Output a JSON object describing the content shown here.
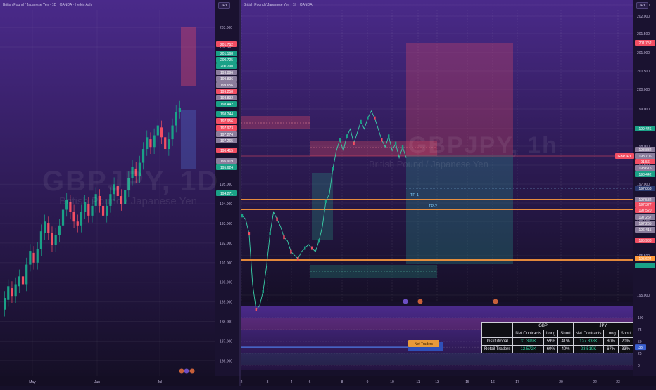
{
  "left_pane": {
    "title": "British Pound / Japanese Yen · 1D · OANDA · Heikin Ashi",
    "currency": "JPY",
    "watermark_symbol": "GBPJPY, 1D",
    "watermark_name": "British Pound / Japanese Yen"
  },
  "right_pane": {
    "title": "British Pound / Japanese Yen · 1h · OANDA",
    "currency": "JPY",
    "watermark_symbol": "GBPJPY, 1h",
    "watermark_name": "British Pound / Japanese Yen"
  },
  "colors": {
    "bull": "#1aa187",
    "bear": "#f24e63",
    "level_line": "#ff9a3c",
    "background_top": "#4a2a8a",
    "background_bottom": "#150f26"
  },
  "chart_data": [
    {
      "type": "candlestick",
      "name": "daily",
      "x_ticks": [
        "May",
        "Jun",
        "Jul"
      ],
      "y_ticks": [
        "203.000",
        "202.000",
        "195.000",
        "194.000",
        "193.000",
        "192.000",
        "191.000",
        "190.000",
        "189.000",
        "188.000",
        "187.000",
        "186.000"
      ],
      "ylim": [
        185.4,
        203.9
      ],
      "candles": [
        {
          "o": 188.6,
          "c": 189.2
        },
        {
          "o": 189.1,
          "c": 189.8
        },
        {
          "o": 189.7,
          "c": 189.3
        },
        {
          "o": 189.3,
          "c": 189.9
        },
        {
          "o": 189.8,
          "c": 190.3
        },
        {
          "o": 190.3,
          "c": 189.9
        },
        {
          "o": 189.9,
          "c": 190.9
        },
        {
          "o": 190.9,
          "c": 191.6
        },
        {
          "o": 191.5,
          "c": 191.0
        },
        {
          "o": 191.0,
          "c": 191.7
        },
        {
          "o": 191.7,
          "c": 192.6
        },
        {
          "o": 192.5,
          "c": 193.1
        },
        {
          "o": 193.0,
          "c": 192.5
        },
        {
          "o": 192.5,
          "c": 191.9
        },
        {
          "o": 191.9,
          "c": 192.4
        },
        {
          "o": 192.4,
          "c": 192.9
        },
        {
          "o": 192.9,
          "c": 193.7
        },
        {
          "o": 193.7,
          "c": 194.2
        },
        {
          "o": 194.1,
          "c": 193.6
        },
        {
          "o": 193.6,
          "c": 193.1
        },
        {
          "o": 193.1,
          "c": 192.9
        },
        {
          "o": 192.9,
          "c": 193.6
        },
        {
          "o": 193.6,
          "c": 194.1
        },
        {
          "o": 194.0,
          "c": 193.4
        },
        {
          "o": 193.4,
          "c": 193.9
        },
        {
          "o": 193.9,
          "c": 194.5
        },
        {
          "o": 194.4,
          "c": 193.9
        },
        {
          "o": 193.9,
          "c": 193.4
        },
        {
          "o": 193.4,
          "c": 193.9
        },
        {
          "o": 193.9,
          "c": 194.5
        },
        {
          "o": 194.5,
          "c": 195.0
        },
        {
          "o": 194.9,
          "c": 194.4
        },
        {
          "o": 194.4,
          "c": 194.0
        },
        {
          "o": 194.0,
          "c": 194.7
        },
        {
          "o": 194.7,
          "c": 195.3
        },
        {
          "o": 195.3,
          "c": 195.9
        },
        {
          "o": 195.8,
          "c": 195.4
        },
        {
          "o": 195.4,
          "c": 196.1
        },
        {
          "o": 196.1,
          "c": 196.8
        },
        {
          "o": 196.8,
          "c": 197.4
        },
        {
          "o": 197.3,
          "c": 196.9
        },
        {
          "o": 196.9,
          "c": 197.5
        },
        {
          "o": 197.5,
          "c": 198.0
        },
        {
          "o": 197.9,
          "c": 197.4
        },
        {
          "o": 197.4,
          "c": 196.8
        },
        {
          "o": 196.8,
          "c": 197.3
        },
        {
          "o": 197.3,
          "c": 198.0
        },
        {
          "o": 198.0,
          "c": 198.7
        },
        {
          "o": 198.7,
          "c": 198.9
        }
      ]
    },
    {
      "type": "line",
      "name": "hourly",
      "x_ticks": [
        "2",
        "3",
        "4",
        "6",
        "8",
        "9",
        "10",
        "11",
        "13",
        "15",
        "16",
        "17",
        "20",
        "22",
        "23"
      ],
      "y_ticks": [
        "202.500",
        "202.000",
        "201.500",
        "201.000",
        "200.500",
        "200.000",
        "199.000",
        "198.500",
        "198.000",
        "197.500",
        "197.000",
        "196.500",
        "196.000",
        "195.500",
        "195.000"
      ],
      "ylim": [
        194.7,
        202.7
      ],
      "series": [
        {
          "values": [
            197.0,
            196.9,
            196.5,
            195.1,
            194.4,
            194.5,
            194.9,
            195.6,
            196.5,
            197.1,
            196.9,
            196.7,
            196.4,
            196.3,
            196.0,
            195.9,
            195.8,
            196.0,
            196.1,
            196.2,
            196.1,
            196.0,
            196.3,
            196.7,
            197.4,
            197.6,
            198.3,
            198.8,
            199.1,
            198.8,
            199.2,
            199.4,
            199.0,
            199.3,
            199.6,
            199.4,
            199.7,
            199.9,
            199.7,
            199.4,
            199.1,
            198.9,
            199.2,
            198.8,
            199.0,
            198.6,
            198.9,
            198.6
          ]
        }
      ],
      "annotations": [
        "TP-1",
        "TP-2"
      ],
      "price_labels": [
        "201.752",
        "199.446",
        "198.832",
        "198.706",
        "91:56",
        "198.615",
        "198.442",
        "197.858",
        "197.582",
        "197.377",
        "197.520",
        "197.267",
        "197.265",
        "196.415",
        "195.938",
        "195.624"
      ],
      "symbol_label": "GBPJPY"
    },
    {
      "type": "line",
      "name": "oscillator",
      "y_ticks": [
        "100",
        "75",
        "50",
        "38",
        "25",
        "0"
      ],
      "ylim": [
        0,
        100
      ],
      "series": [
        {
          "values": [
            38,
            38,
            38,
            38,
            38,
            38,
            38,
            38,
            38,
            38,
            38,
            38
          ]
        }
      ],
      "annotation": "Net Traders"
    },
    {
      "type": "table",
      "name": "cot-table",
      "headers": [
        "",
        "GBP",
        "JPY"
      ],
      "subheaders": [
        "",
        "Net Contracts",
        "Long",
        "Short",
        "Net Contracts",
        "Long",
        "Short"
      ],
      "rows": [
        {
          "label": "Institutional",
          "cells": [
            "31.399K",
            "59%",
            "41%",
            "127.338K",
            "80%",
            "20%"
          ]
        },
        {
          "label": "Retail Traders",
          "cells": [
            "12.572K",
            "60%",
            "40%",
            "23.519K",
            "67%",
            "33%"
          ]
        }
      ]
    }
  ]
}
